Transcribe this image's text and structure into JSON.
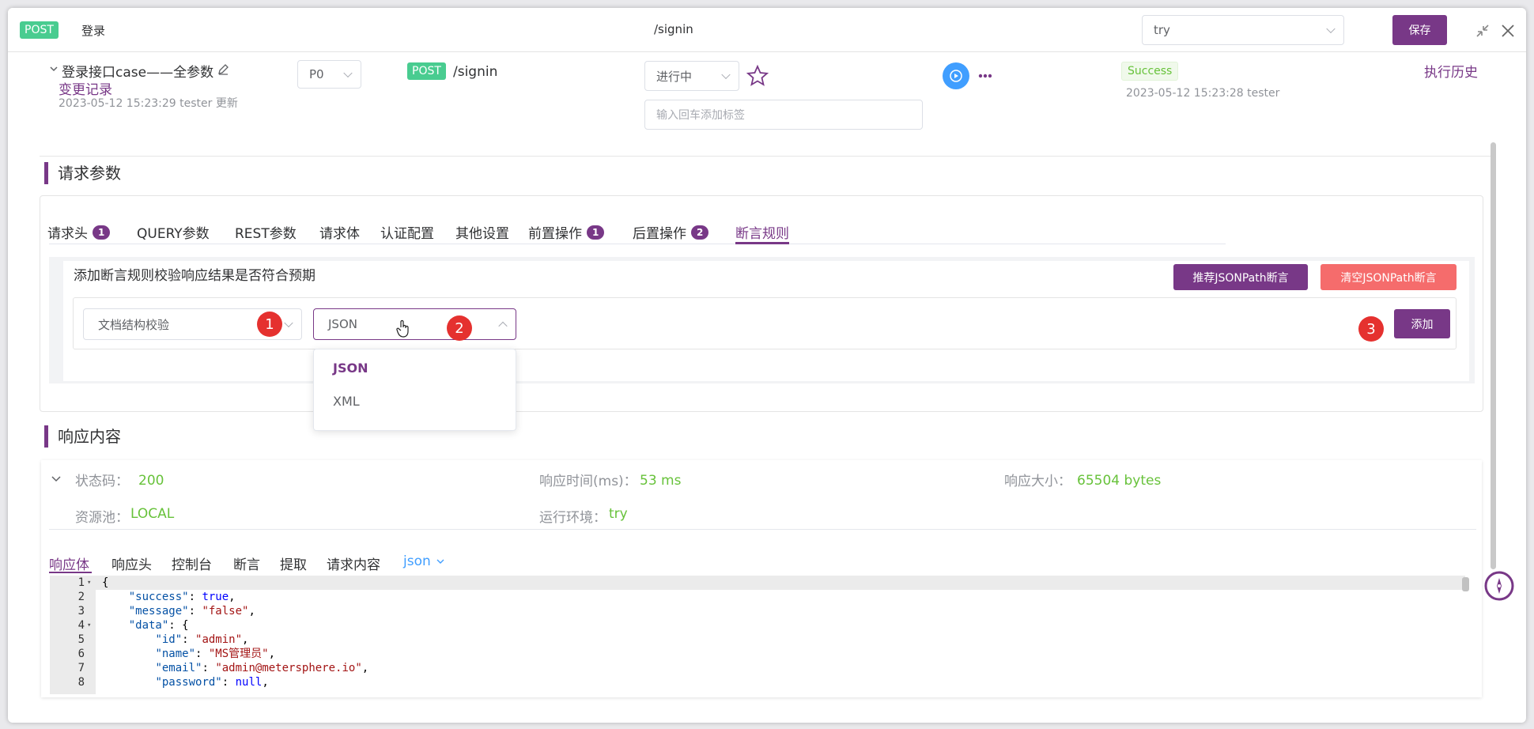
{
  "topbar": {
    "method": "POST",
    "name": "登录",
    "path": "/signin",
    "env": "try",
    "save": "保存"
  },
  "case": {
    "title": "登录接口case——全参数",
    "change_log": "变更记录",
    "updated": "2023-05-12 15:23:29 tester 更新",
    "priority": "P0",
    "method": "POST",
    "path": "/signin",
    "status": "进行中",
    "tag_placeholder": "输入回车添加标签",
    "result": "Success",
    "run_info": "2023-05-12 15:23:28 tester",
    "history": "执行历史"
  },
  "request": {
    "title": "请求参数",
    "tabs": [
      {
        "label": "请求头",
        "count": "1"
      },
      {
        "label": "QUERY参数"
      },
      {
        "label": "REST参数"
      },
      {
        "label": "请求体"
      },
      {
        "label": "认证配置"
      },
      {
        "label": "其他设置"
      },
      {
        "label": "前置操作",
        "count": "1"
      },
      {
        "label": "后置操作",
        "count": "2"
      },
      {
        "label": "断言规则"
      }
    ],
    "assert": {
      "hint": "添加断言规则校验响应结果是否符合预期",
      "btn_recommend": "推荐JSONPath断言",
      "btn_clear": "清空JSONPath断言",
      "type_select": "文档结构校验",
      "format_select": "JSON",
      "add": "添加",
      "options": [
        "JSON",
        "XML"
      ],
      "markers": [
        "1",
        "2",
        "3"
      ]
    }
  },
  "response": {
    "title": "响应内容",
    "status_label": "状态码：",
    "status": "200",
    "time_label": "响应时间(ms)：",
    "time": "53 ms",
    "size_label": "响应大小：",
    "size": "65504 bytes",
    "pool_label": "资源池：",
    "pool": "LOCAL",
    "env_label": "运行环境：",
    "env": "try",
    "tabs": [
      "响应体",
      "响应头",
      "控制台",
      "断言",
      "提取",
      "请求内容"
    ],
    "format": "json",
    "code": [
      {
        "n": "1",
        "fold": true
      },
      {
        "n": "2"
      },
      {
        "n": "3"
      },
      {
        "n": "4",
        "fold": true
      },
      {
        "n": "5"
      },
      {
        "n": "6"
      },
      {
        "n": "7"
      },
      {
        "n": "8"
      }
    ]
  },
  "colors": {
    "accent": "#783887",
    "success": "#67c23a",
    "post": "#49cc90",
    "danger": "#f56c6c"
  }
}
